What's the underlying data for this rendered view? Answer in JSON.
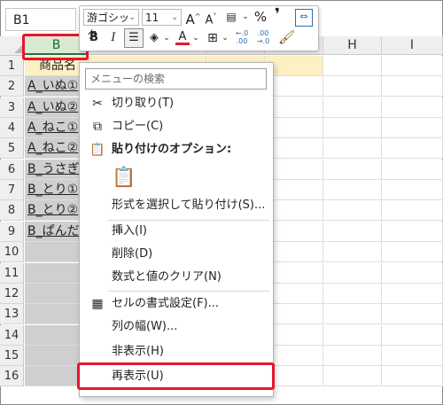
{
  "name_box": "B1",
  "columns": [
    "B",
    "H",
    "I"
  ],
  "rows": [
    "1",
    "2",
    "3",
    "4",
    "5",
    "6",
    "7",
    "8",
    "9",
    "10",
    "11",
    "12",
    "13",
    "14",
    "15",
    "16"
  ],
  "cells_b": [
    "商品名",
    "A_いぬ①",
    "A_いぬ②",
    "A_ねこ①",
    "A_ねこ②",
    "B_うさぎ",
    "B_とり①",
    "B_とり②",
    "B_ぱんだ"
  ],
  "mini_toolbar": {
    "font_name": "游ゴシック",
    "font_size": "11",
    "grow_font": "A^",
    "shrink_font": "A˅",
    "percent": "%",
    "comma": "9",
    "bold": "B",
    "italic": "I",
    "font_color_letter": "A",
    "dec_inc": "←.0 .00",
    "dec_dec": ".00 →.0"
  },
  "context_menu": {
    "search_placeholder": "メニューの検索",
    "items": [
      {
        "label": "切り取り(T)",
        "icon": "scissors-icon"
      },
      {
        "label": "コピー(C)",
        "icon": "copy-icon"
      },
      {
        "label": "貼り付けのオプション:",
        "icon": "paste-icon"
      },
      {
        "label": "形式を選択して貼り付け(S)...",
        "icon": ""
      },
      {
        "label": "挿入(I)",
        "icon": ""
      },
      {
        "label": "削除(D)",
        "icon": ""
      },
      {
        "label": "数式と値のクリア(N)",
        "icon": ""
      },
      {
        "label": "セルの書式設定(F)...",
        "icon": "format-cells-icon"
      },
      {
        "label": "列の幅(W)...",
        "icon": ""
      },
      {
        "label": "非表示(H)",
        "icon": ""
      },
      {
        "label": "再表示(U)",
        "icon": ""
      }
    ]
  },
  "colors": {
    "accent_red": "#e6162d",
    "header_fill": "#fdf0c4",
    "selected_col": "#cfcfcf"
  }
}
